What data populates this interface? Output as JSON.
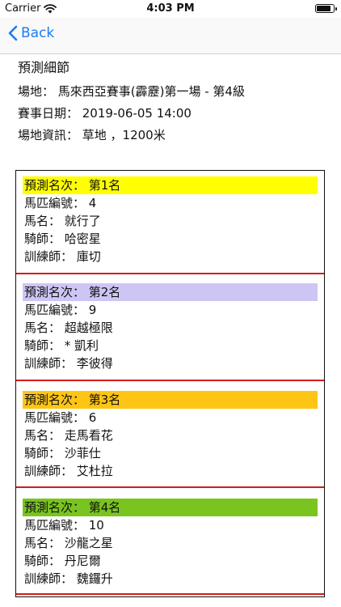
{
  "status_bar": {
    "carrier": "Carrier",
    "time": "4:03 PM"
  },
  "nav": {
    "back_label": "Back"
  },
  "details": {
    "title": "預測細節",
    "venue": "場地：  馬來西亞賽事(霹靂)第一場 - 第4級",
    "date": "賽事日期：  2019-06-05   14:00",
    "track": "場地資訊：  草地  ，1200米"
  },
  "predictions": [
    {
      "rank": "預測名次：  第1名",
      "number": "馬匹編號：  4",
      "horse": "馬名：  就行了",
      "jockey": "騎師：  哈密星",
      "trainer": "訓練師：  庫切",
      "color": "#ffff00"
    },
    {
      "rank": "預測名次：  第2名",
      "number": "馬匹編號：  9",
      "horse": "馬名：  超越極限",
      "jockey": "騎師：  * 凱利",
      "trainer": "訓練師：  李彼得",
      "color": "#cdc6f5"
    },
    {
      "rank": "預測名次：  第3名",
      "number": "馬匹編號：  6",
      "horse": "馬名：  走馬看花",
      "jockey": "騎師：  沙菲仕",
      "trainer": "訓練師：  艾杜拉",
      "color": "#ffc515"
    },
    {
      "rank": "預測名次：  第4名",
      "number": "馬匹編號：  10",
      "horse": "馬名：  沙龍之星",
      "jockey": "騎師：  丹尼爾",
      "trainer": "訓練師：  魏鑼升",
      "color": "#7ac41f"
    }
  ]
}
